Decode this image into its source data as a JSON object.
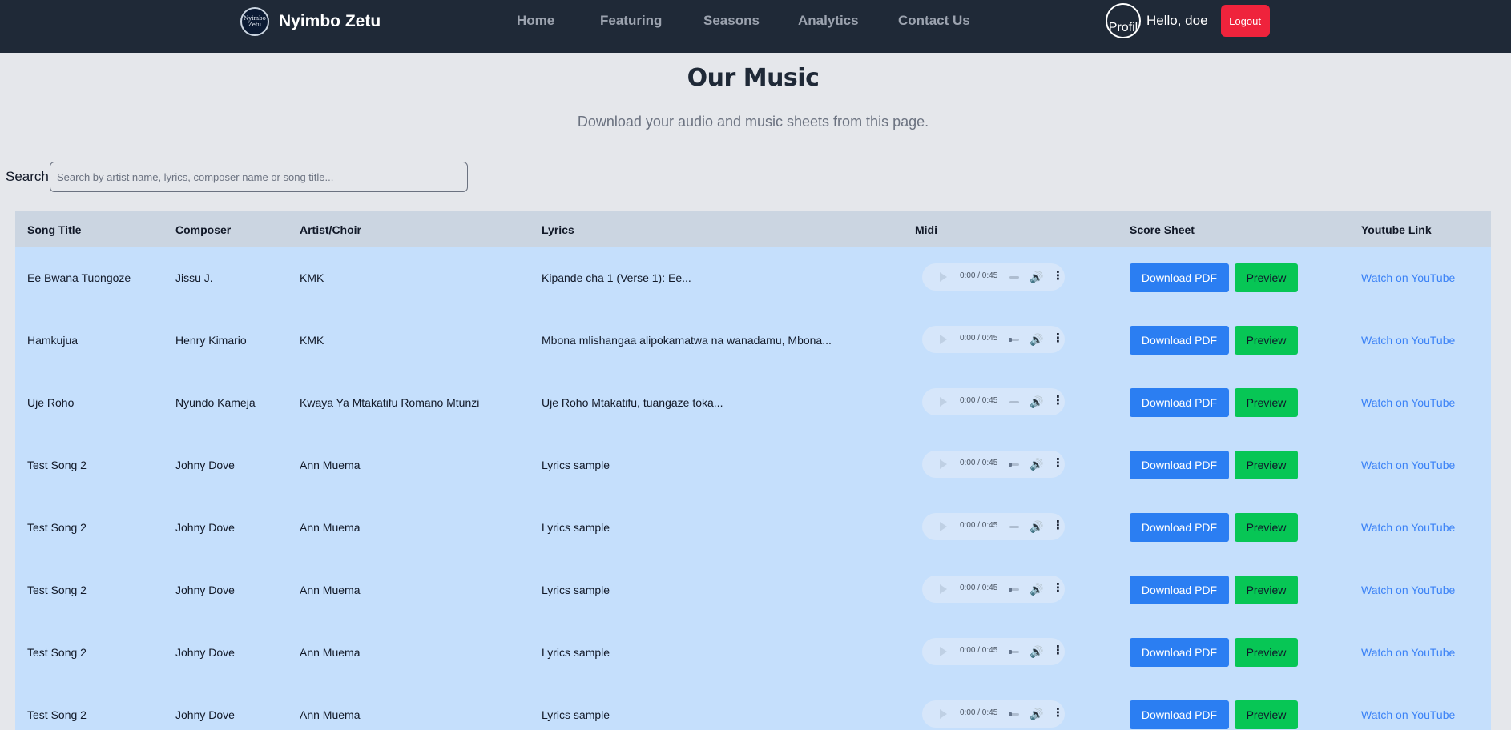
{
  "nav": {
    "logo_text": "Nyimbo Zetu",
    "brand": "Nyimbo Zetu",
    "links": [
      "Home",
      "Featuring",
      "Seasons",
      "Analytics",
      "Contact Us"
    ],
    "avatar_alt": "Profil",
    "greeting": "Hello, doe",
    "logout": "Logout"
  },
  "header": {
    "title": "Our Music",
    "subtitle": "Download your audio and music sheets from this page."
  },
  "search": {
    "label": "Search",
    "placeholder": "Search by artist name, lyrics, composer name or song title...",
    "value": ""
  },
  "table": {
    "headers": [
      "Song Title",
      "Composer",
      "Artist/Choir",
      "Lyrics",
      "Midi",
      "Score Sheet",
      "Youtube Link"
    ],
    "download_label": "Download PDF",
    "preview_label": "Preview",
    "youtube_label": "Watch on YouTube",
    "rows": [
      {
        "title": "Ee Bwana Tuongoze",
        "composer": "Jissu J.",
        "artist": "KMK",
        "lyrics": "Kipande cha 1 (Verse 1): Ee...",
        "time": "0:00 / 0:45"
      },
      {
        "title": "Hamkujua",
        "composer": "Henry Kimario",
        "artist": "KMK",
        "lyrics": "Mbona mlishangaa alipokamatwa na wanadamu, Mbona...",
        "time": "0:00 / 0:45"
      },
      {
        "title": "Uje Roho",
        "composer": "Nyundo Kameja",
        "artist": "Kwaya Ya Mtakatifu Romano Mtunzi",
        "lyrics": "Uje Roho Mtakatifu, tuangaze toka...",
        "time": "0:00 / 0:45"
      },
      {
        "title": "Test Song 2",
        "composer": "Johny Dove",
        "artist": "Ann Muema",
        "lyrics": "Lyrics sample",
        "time": "0:00 / 0:45"
      },
      {
        "title": "Test Song 2",
        "composer": "Johny Dove",
        "artist": "Ann Muema",
        "lyrics": "Lyrics sample",
        "time": "0:00 / 0:45"
      },
      {
        "title": "Test Song 2",
        "composer": "Johny Dove",
        "artist": "Ann Muema",
        "lyrics": "Lyrics sample",
        "time": "0:00 / 0:45"
      },
      {
        "title": "Test Song 2",
        "composer": "Johny Dove",
        "artist": "Ann Muema",
        "lyrics": "Lyrics sample",
        "time": "0:00 / 0:45"
      },
      {
        "title": "Test Song 2",
        "composer": "Johny Dove",
        "artist": "Ann Muema",
        "lyrics": "Lyrics sample",
        "time": "0:00 / 0:45"
      }
    ]
  },
  "icons": {
    "play": "play-icon",
    "volume": "volume-icon",
    "more": "more-vertical-icon"
  },
  "colors": {
    "navbar": "#1f2937",
    "logout": "#ef233c",
    "download": "#2b7ef2",
    "preview": "#07c655",
    "link": "#3b82f6",
    "table_bg": "#c5dffc",
    "table_header": "#cbd5e1"
  }
}
